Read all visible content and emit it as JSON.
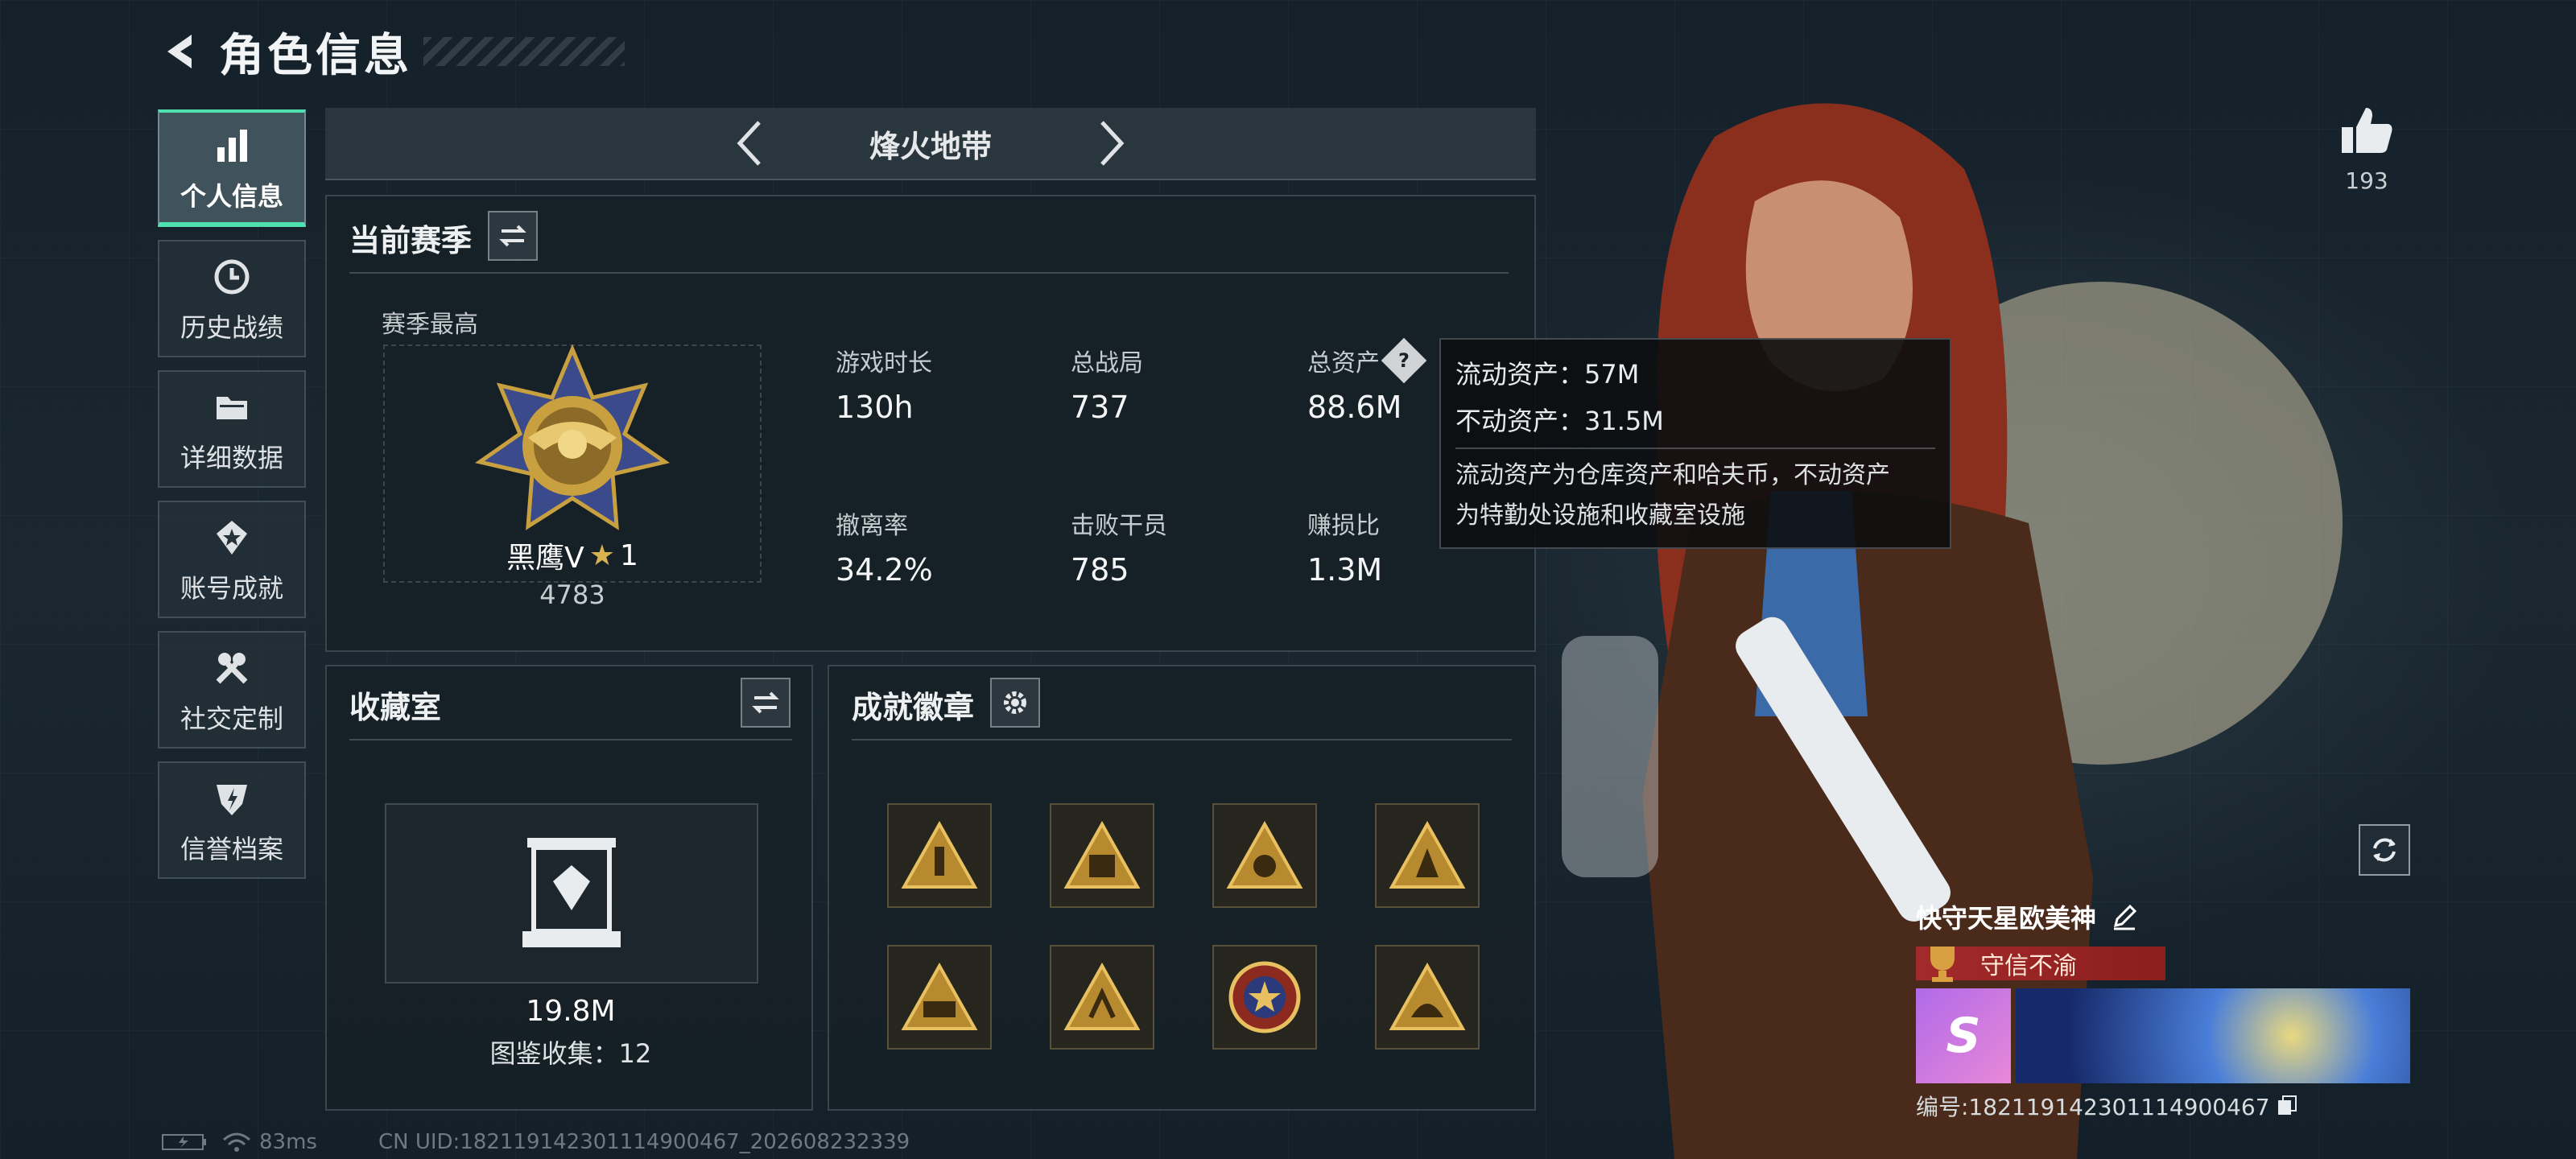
{
  "header": {
    "title": "角色信息"
  },
  "sidebar": {
    "items": [
      {
        "label": "个人信息",
        "icon": "bar-chart-icon",
        "active": true
      },
      {
        "label": "历史战绩",
        "icon": "history-clock-icon"
      },
      {
        "label": "详细数据",
        "icon": "folder-icon"
      },
      {
        "label": "账号成就",
        "icon": "medal-icon"
      },
      {
        "label": "社交定制",
        "icon": "wrench-icon"
      },
      {
        "label": "信誉档案",
        "icon": "shield-icon"
      }
    ]
  },
  "mode": {
    "name": "烽火地带"
  },
  "season": {
    "title": "当前赛季",
    "best_label": "赛季最高",
    "rank_name": "黑鹰Ⅴ",
    "rank_stars": "1",
    "rank_score": "4783",
    "stats": [
      {
        "key": "游戏时长",
        "value": "130h"
      },
      {
        "key": "总战局",
        "value": "737"
      },
      {
        "key": "总资产",
        "value": "88.6M"
      },
      {
        "key": "撤离率",
        "value": "34.2%"
      },
      {
        "key": "击败干员",
        "value": "785"
      },
      {
        "key": "赚损比",
        "value": "1.3M"
      }
    ]
  },
  "tooltip": {
    "liquid": "流动资产：57M",
    "fixed": "不动资产：31.5M",
    "desc1": "流动资产为仓库资产和哈夫币，不动资产",
    "desc2": "为特勤处设施和收藏室设施"
  },
  "collection": {
    "title": "收藏室",
    "value": "19.8M",
    "count": "图鉴收集：12"
  },
  "achievements": {
    "title": "成就徽章",
    "badges": [
      "badge-1",
      "badge-2",
      "badge-3",
      "badge-4",
      "badge-5",
      "badge-6",
      "badge-7",
      "badge-8"
    ]
  },
  "likes": {
    "count": "193"
  },
  "player": {
    "name": "快守天星欧美神",
    "honor": "守信不渝",
    "id": "编号:1821191423011149004​67"
  },
  "footer": {
    "ping": "83ms",
    "uid": "CN UID:1821191423011149004​67_202608232339"
  },
  "colors": {
    "accent": "#4fe0b0",
    "honor_red": "#a32a2a",
    "gold": "#c9a040"
  }
}
